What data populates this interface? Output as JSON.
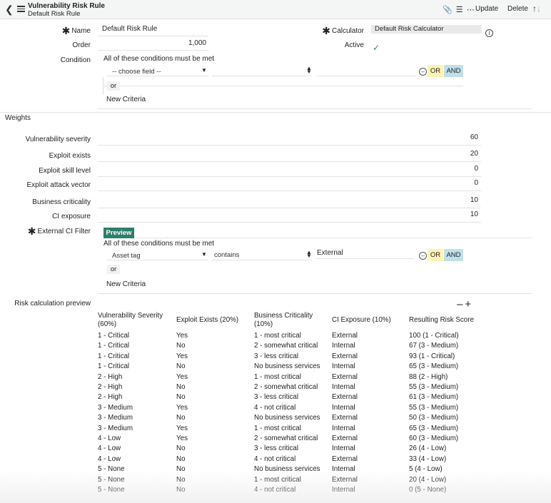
{
  "header": {
    "title": "Vulnerability Risk Rule",
    "subtitle": "Default Risk Rule",
    "update_label": "Update",
    "delete_label": "Delete",
    "icons": [
      "back-icon",
      "menu-icon",
      "attachment-icon",
      "settings-icon",
      "more-icon",
      "arrow-up-icon",
      "arrow-down-icon"
    ]
  },
  "form": {
    "name_label": "Name",
    "name_value": "Default Risk Rule",
    "order_label": "Order",
    "order_value": "1,000",
    "condition_label": "Condition",
    "calculator_label": "Calculator",
    "calculator_value": "Default Risk Calculator",
    "active_label": "Active",
    "active_value": true
  },
  "condition_builder": {
    "heading": "All of these conditions must be met",
    "field_placeholder": "-- choose field --",
    "or_label": "OR",
    "and_label": "AND",
    "or_tag": "or",
    "new_criteria": "New Criteria"
  },
  "weights": {
    "section_title": "Weights",
    "items": [
      {
        "label": "Vulnerability severity",
        "value": "60"
      },
      {
        "label": "Exploit exists",
        "value": "20"
      },
      {
        "label": "Exploit skill level",
        "value": "0"
      },
      {
        "label": "Exploit attack vector",
        "value": "0"
      },
      {
        "label": "Business criticality",
        "value": "10"
      },
      {
        "label": "CI exposure",
        "value": "10"
      }
    ]
  },
  "external_filter": {
    "label": "External CI Filter",
    "preview_label": "Preview",
    "heading": "All of these conditions must be met",
    "field": "Asset tag",
    "operator": "contains",
    "value": "External",
    "or_label": "OR",
    "and_label": "AND",
    "or_tag": "or",
    "new_criteria": "New Criteria"
  },
  "risk_preview": {
    "label": "Risk calculation preview",
    "columns": [
      "Vulnerability Severity (60%)",
      "Exploit Exists (20%)",
      "Business Criticality (10%)",
      "CI Exposure (10%)",
      "Resulting Risk Score"
    ],
    "rows": [
      [
        "1 - Critical",
        "Yes",
        "1 - most critical",
        "External",
        "100 (1 - Critical)"
      ],
      [
        "1 - Critical",
        "No",
        "2 - somewhat critical",
        "Internal",
        "67 (3 - Medium)"
      ],
      [
        "1 - Critical",
        "Yes",
        "3 - less critical",
        "External",
        "93 (1 - Critical)"
      ],
      [
        "1 - Critical",
        "No",
        "No business services",
        "Internal",
        "65 (3 - Medium)"
      ],
      [
        "2 - High",
        "Yes",
        "1 - most critical",
        "External",
        "88 (2 - High)"
      ],
      [
        "2 - High",
        "No",
        "2 - somewhat critical",
        "Internal",
        "55 (3 - Medium)"
      ],
      [
        "2 - High",
        "No",
        "3 - less critical",
        "External",
        "61 (3 - Medium)"
      ],
      [
        "3 - Medium",
        "Yes",
        "4 - not critical",
        "Internal",
        "55 (3 - Medium)"
      ],
      [
        "3 - Medium",
        "No",
        "No business services",
        "External",
        "50 (3 - Medium)"
      ],
      [
        "3 - Medium",
        "Yes",
        "1 - most critical",
        "Internal",
        "65 (3 - Medium)"
      ],
      [
        "4 - Low",
        "Yes",
        "2 - somewhat critical",
        "External",
        "60 (3 - Medium)"
      ],
      [
        "4 - Low",
        "No",
        "3 - less critical",
        "Internal",
        "26 (4 - Low)"
      ],
      [
        "4 - Low",
        "No",
        "4 - not critical",
        "External",
        "33 (4 - Low)"
      ],
      [
        "5 - None",
        "No",
        "No business services",
        "Internal",
        "5 (4 - Low)"
      ],
      [
        "5 - None",
        "No",
        "1 - most critical",
        "External",
        "20 (4 - Low)"
      ],
      [
        "5 - None",
        "No",
        "4 - not critical",
        "Internal",
        "0 (5 - None)"
      ]
    ]
  },
  "colors": {
    "header_bg": "#f4f5f5",
    "or_bg": "#fcf3b5",
    "and_bg": "#bfe0eb",
    "preview_bg": "#2e7d6d",
    "check": "#2e8a4f"
  }
}
